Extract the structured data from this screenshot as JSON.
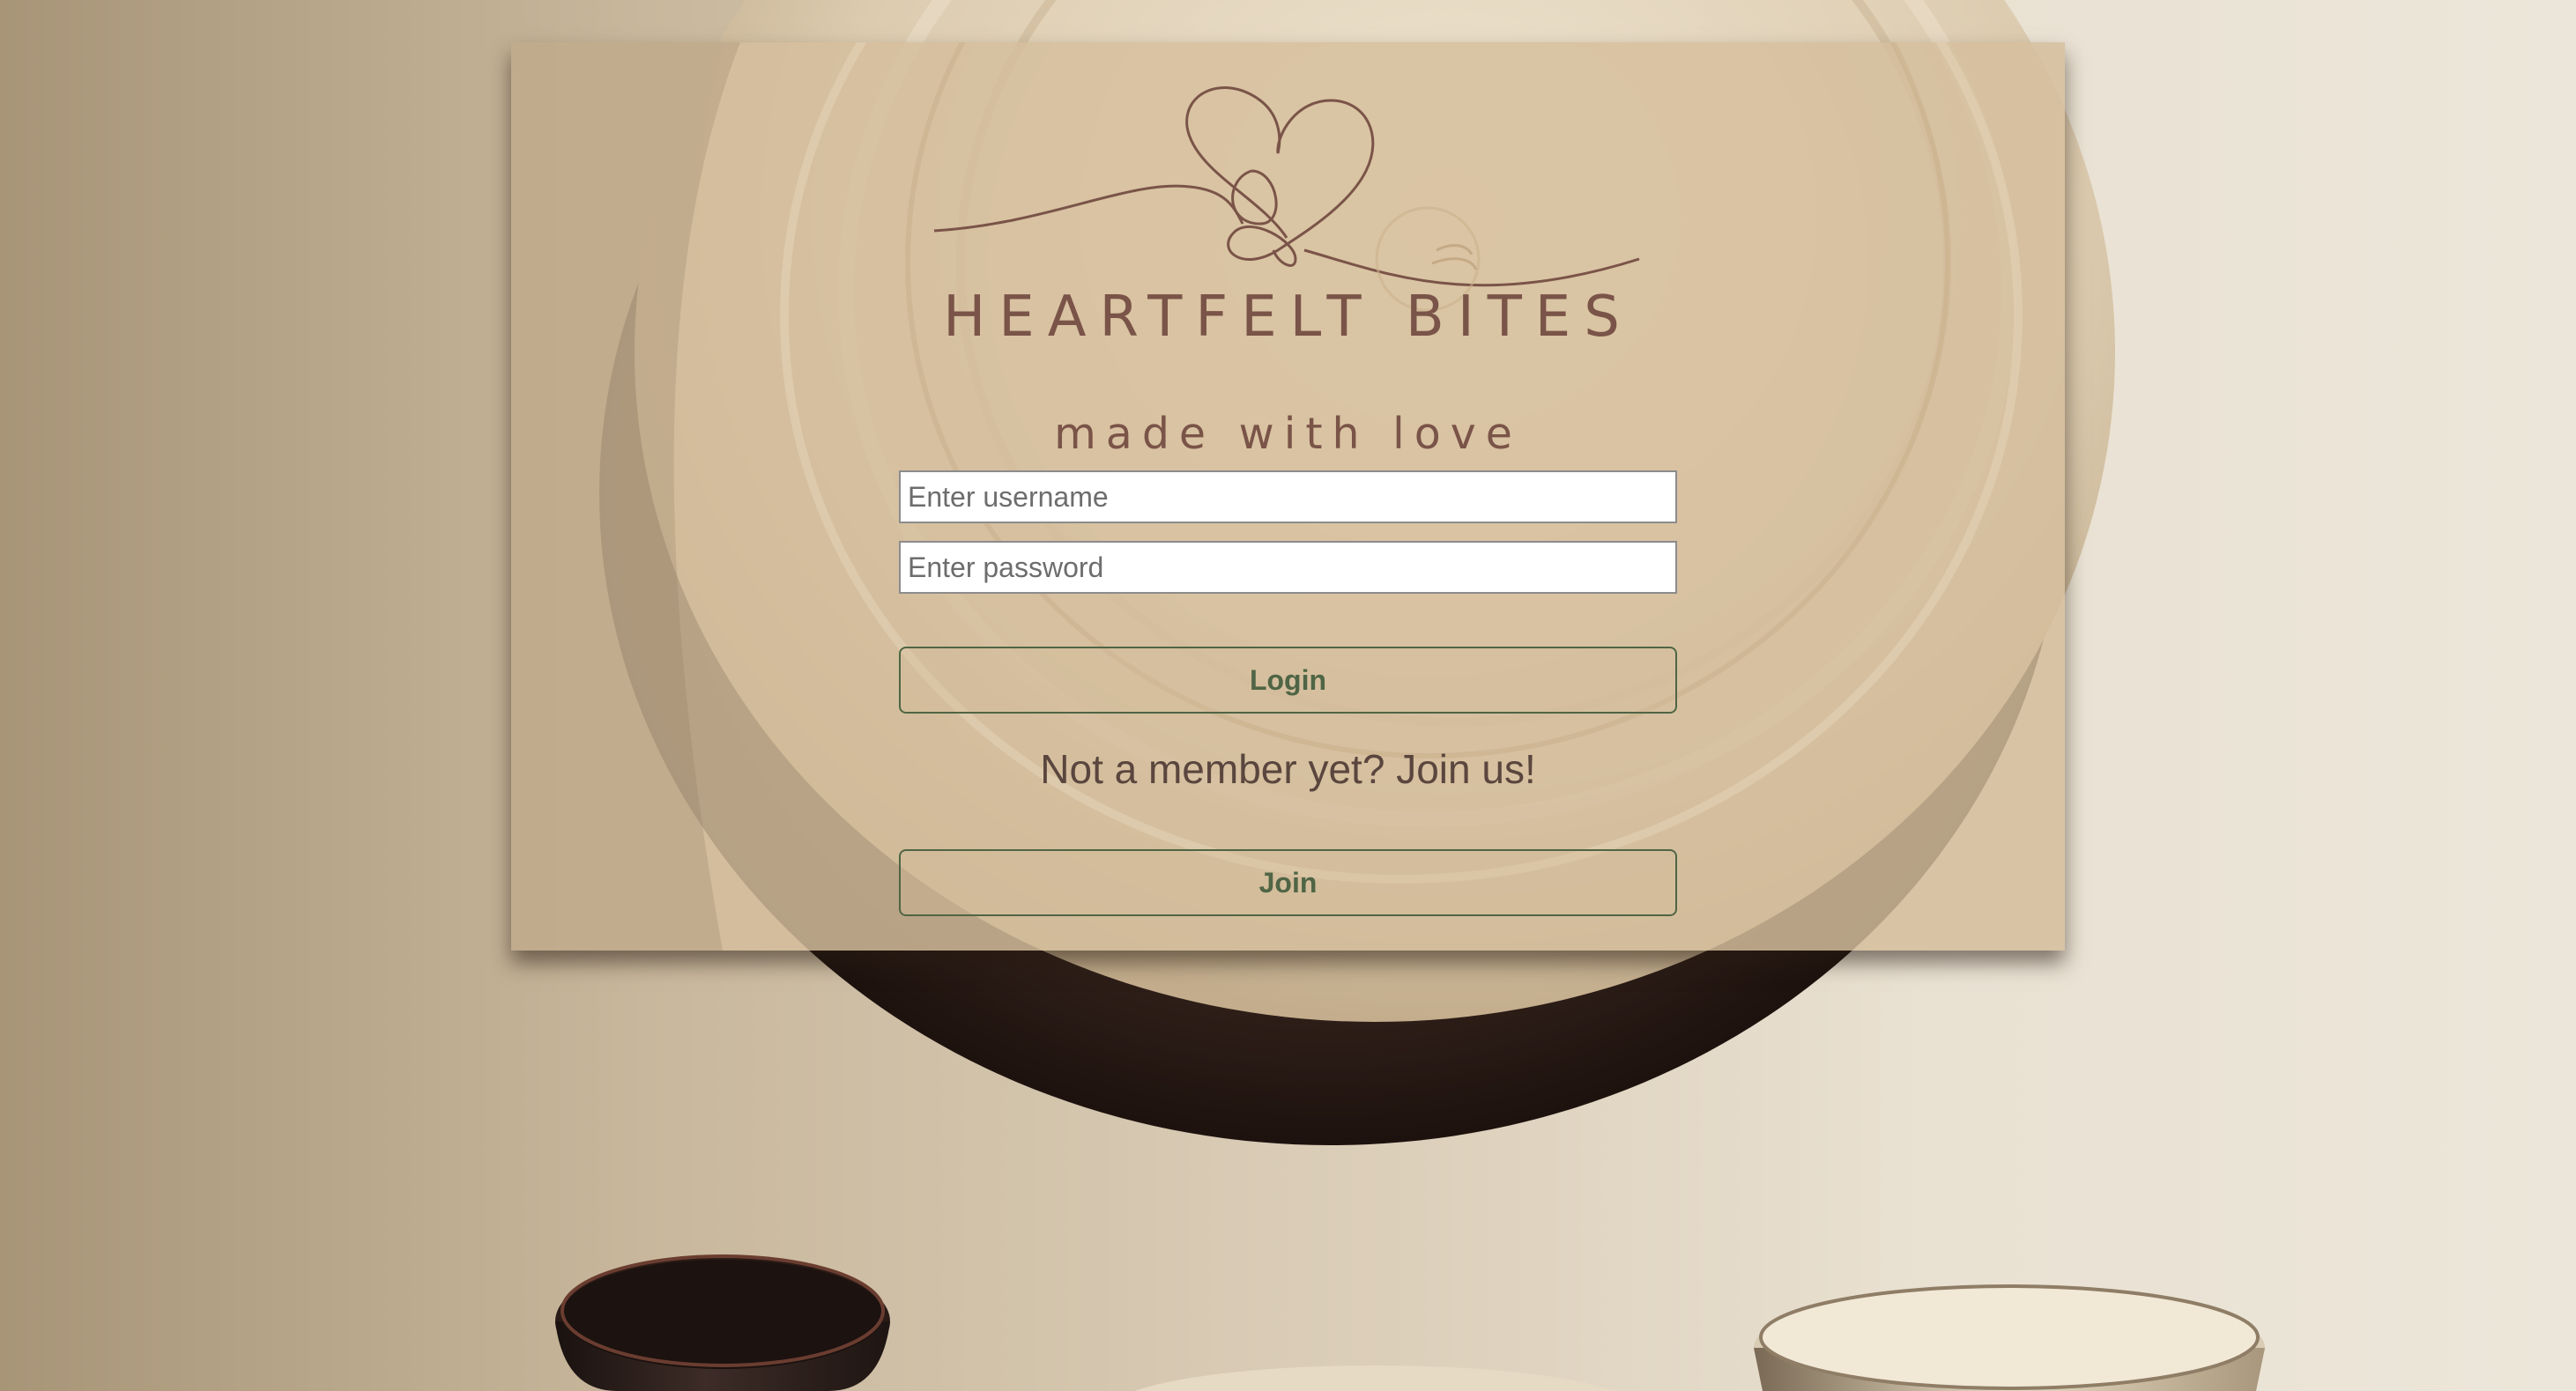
{
  "brand": {
    "name": "HEARTFELT BITES",
    "tagline": "made with love"
  },
  "login_form": {
    "username_placeholder": "Enter username",
    "password_placeholder": "Enter password",
    "login_label": "Login"
  },
  "signup": {
    "prompt": "Not a member yet? Join us!",
    "join_label": "Join"
  },
  "colors": {
    "panel": "#d4bd9c",
    "brand_text": "#7a5448",
    "button_accent": "#4f6545",
    "prompt_text": "#5a463e"
  }
}
